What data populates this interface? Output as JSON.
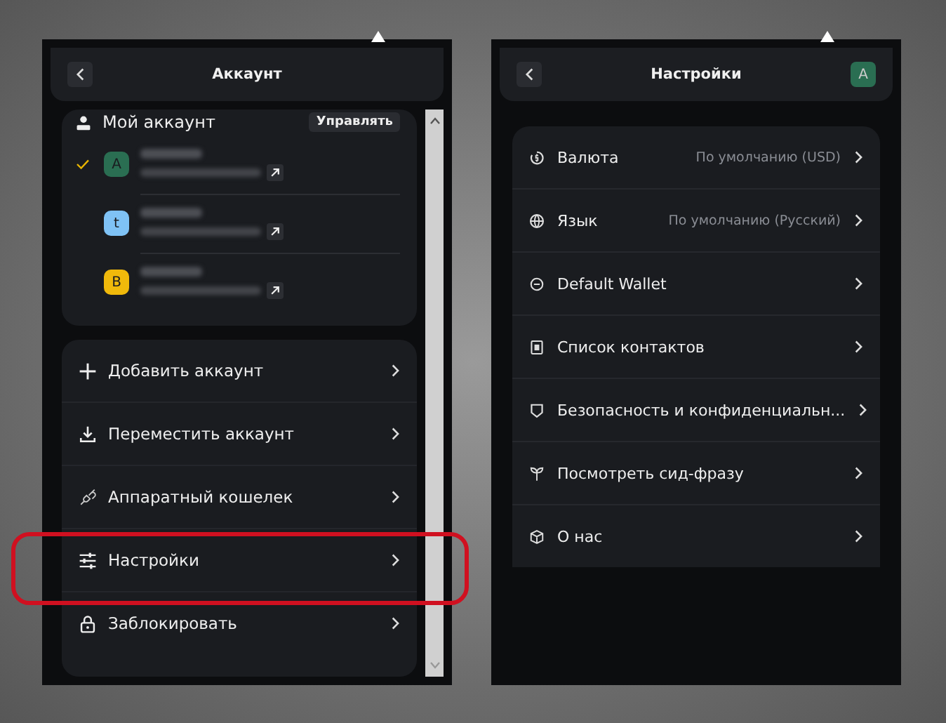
{
  "left_panel": {
    "title": "Аккаунт",
    "section_title": "Мой аккаунт",
    "manage_button": "Управлять",
    "accounts": [
      {
        "letter": "A",
        "color": "#2a6e52",
        "selected": true
      },
      {
        "letter": "t",
        "color": "#7fc2f5",
        "selected": false
      },
      {
        "letter": "B",
        "color": "#f0b90b",
        "selected": false
      }
    ],
    "menu": [
      {
        "label": "Добавить аккаунт",
        "highlighted": false
      },
      {
        "label": "Переместить аккаунт",
        "highlighted": false
      },
      {
        "label": "Аппаратный кошелек",
        "highlighted": false
      },
      {
        "label": "Настройки",
        "highlighted": true
      },
      {
        "label": "Заблокировать",
        "highlighted": false
      }
    ]
  },
  "right_panel": {
    "title": "Настройки",
    "avatar": {
      "letter": "A",
      "color": "#2a6e52"
    },
    "items": [
      {
        "label": "Валюта",
        "value": "По умолчанию (USD)"
      },
      {
        "label": "Язык",
        "value": "По умолчанию (Русский)"
      },
      {
        "label": "Default Wallet"
      },
      {
        "label": "Список контактов"
      },
      {
        "label": "Безопасность и конфиденциальн..."
      },
      {
        "label": "Посмотреть сид-фразу"
      },
      {
        "label": "О нас"
      }
    ]
  }
}
